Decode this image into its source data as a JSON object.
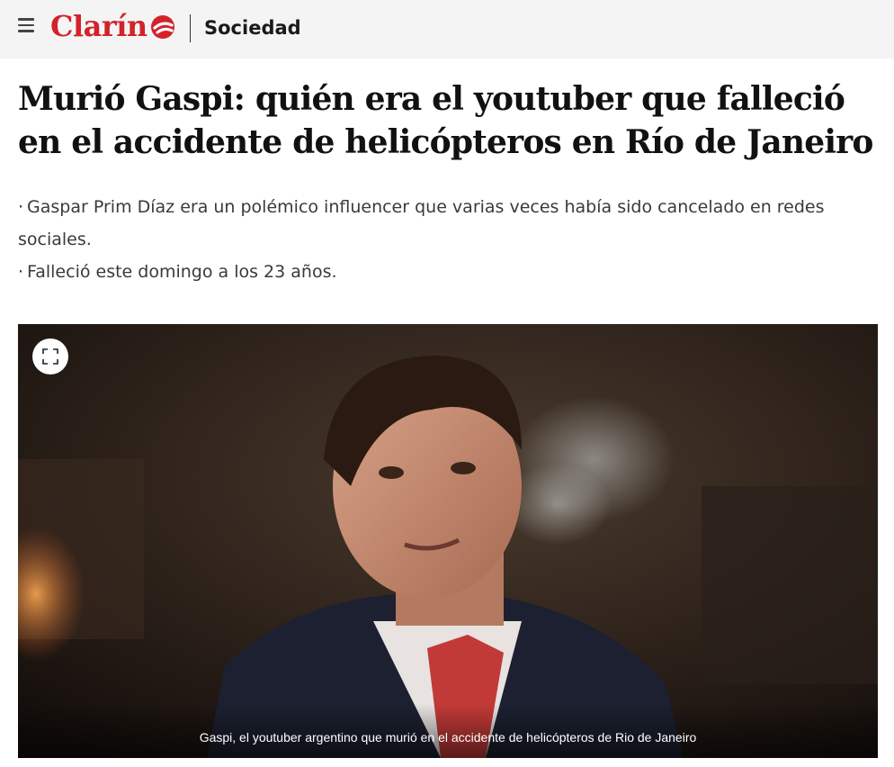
{
  "header": {
    "menu_icon": "hamburger-menu-icon",
    "logo_text": "Clarín",
    "brand_color": "#d3222a",
    "section_label": "Sociedad"
  },
  "article": {
    "headline": "Murió Gaspi: quién era el youtuber que falleció en el accidente de helicópteros en Río de Janeiro",
    "summary": [
      "Gaspar Prim Díaz era un polémico influencer que varias veces había sido cancelado en redes sociales.",
      "Falleció este domingo a los 23 años."
    ],
    "bullet": "·"
  },
  "media": {
    "expand_icon": "fullscreen-expand-icon",
    "caption": "Gaspi, el youtuber argentino que murió en el accidente de helicópteros de Rio de Janeiro"
  }
}
